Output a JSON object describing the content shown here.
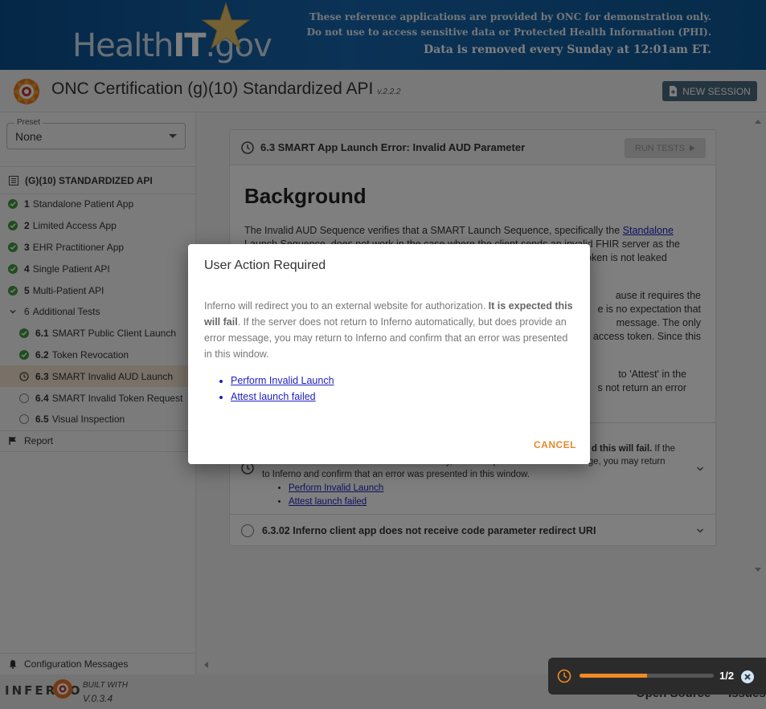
{
  "banner": {
    "logo_light": "Health",
    "logo_bold": "IT",
    "logo_suffix": ".gov",
    "notice_line1": "These reference applications are provided by ONC for demonstration only.",
    "notice_line2": "Do not use to access sensitive data or Protected Health Information (PHI).",
    "notice_line3": "Data is removed every Sunday at 12:01am ET."
  },
  "header": {
    "title": "ONC Certification (g)(10) Standardized API",
    "version": "v.2.2.2",
    "new_session_label": "NEW SESSION"
  },
  "sidebar": {
    "preset_label": "Preset",
    "preset_value": "None",
    "suite_title": "(G)(10) STANDARDIZED API",
    "items": [
      {
        "num": "1",
        "label": "Standalone Patient App",
        "status": "pass"
      },
      {
        "num": "2",
        "label": "Limited Access App",
        "status": "pass"
      },
      {
        "num": "3",
        "label": "EHR Practitioner App",
        "status": "pass"
      },
      {
        "num": "4",
        "label": "Single Patient API",
        "status": "pass"
      },
      {
        "num": "5",
        "label": "Multi-Patient API",
        "status": "pass"
      },
      {
        "num": "6",
        "label": "Additional Tests",
        "status": "expanded"
      },
      {
        "num": "6.1",
        "label": "SMART Public Client Launch",
        "status": "pass"
      },
      {
        "num": "6.2",
        "label": "Token Revocation",
        "status": "pass"
      },
      {
        "num": "6.3",
        "label": "SMART Invalid AUD Launch",
        "status": "running"
      },
      {
        "num": "6.4",
        "label": "SMART Invalid Token Request",
        "status": "pending"
      },
      {
        "num": "6.5",
        "label": "Visual Inspection",
        "status": "pending"
      }
    ],
    "report_label": "Report",
    "config_label": "Configuration Messages"
  },
  "main": {
    "group_title": "6.3 SMART App Launch Error: Invalid AUD Parameter",
    "run_tests_label": "RUN TESTS",
    "background_title": "Background",
    "para1_pre": "The Invalid AUD Sequence verifies that a SMART Launch Sequence, specifically the",
    "para1_link": "Standalone",
    "para1_line2": "Launch Sequence, does not work in the case where the client sends an invalid FHIR server as the",
    "para1_line3": "aud parameter during launch. This must fail to ensure that a genuine bearer token is not leaked",
    "para2_line1": "ause it requires the",
    "para2_line2": "e is no expectation that",
    "para2_line3": "message. The only",
    "para2_line4": "access token. Since this",
    "para3_line1": "to 'Attest' in the",
    "para3_line2": "s not return an error",
    "test1_text_a": "d this will fail.",
    "test1_text_b": "If the",
    "test1_line2": "server does not return to Inferno automatically, but does provide an error message, you may return",
    "test1_line3": "to Inferno and confirm that an error was presented in this window.",
    "test1_link1": "Perform Invalid Launch",
    "test1_link2": "Attest launch failed",
    "test2_title": "6.3.02 Inferno client app does not receive code parameter redirect URI"
  },
  "dialog": {
    "title": "User Action Required",
    "body_pre": "Inferno will redirect you to an external website for authorization.",
    "body_bold": "It is expected this will fail",
    "body_post": ". If the server does not return to Inferno automatically, but does provide an error message, you may return to Inferno and confirm that an error was presented in this window.",
    "link1": "Perform Invalid Launch",
    "link2": "Attest launch failed",
    "cancel_label": "CANCEL"
  },
  "footer": {
    "logo_text": "INFERNO",
    "built_with": "BUILT WITH",
    "version": "V.0.3.4",
    "open_source": "Open Source",
    "issues": "Issues"
  },
  "progress": {
    "count": "1/2",
    "fraction": 0.5
  },
  "colors": {
    "accent": "#f08a24",
    "pass": "#3f9b3f",
    "banner": "#1766ad",
    "active_bg": "#f2e2cf"
  }
}
